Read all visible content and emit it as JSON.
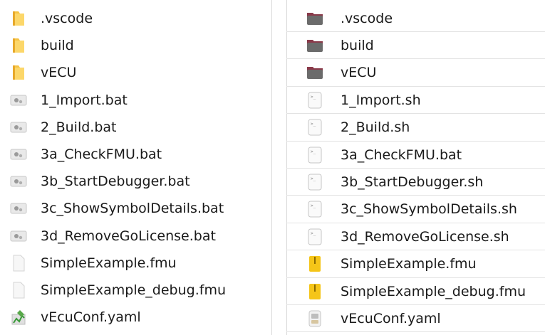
{
  "left_panel": {
    "items": [
      {
        "name": ".vscode",
        "icon": "folder-icon"
      },
      {
        "name": "build",
        "icon": "folder-icon"
      },
      {
        "name": "vECU",
        "icon": "folder-icon"
      },
      {
        "name": "1_Import.bat",
        "icon": "batch-file-icon"
      },
      {
        "name": "2_Build.bat",
        "icon": "batch-file-icon"
      },
      {
        "name": "3a_CheckFMU.bat",
        "icon": "batch-file-icon"
      },
      {
        "name": "3b_StartDebugger.bat",
        "icon": "batch-file-icon"
      },
      {
        "name": "3c_ShowSymbolDetails.bat",
        "icon": "batch-file-icon"
      },
      {
        "name": "3d_RemoveGoLicense.bat",
        "icon": "batch-file-icon"
      },
      {
        "name": "SimpleExample.fmu",
        "icon": "blank-file-icon"
      },
      {
        "name": "SimpleExample_debug.fmu",
        "icon": "blank-file-icon"
      },
      {
        "name": "vEcuConf.yaml",
        "icon": "yaml-file-icon"
      }
    ]
  },
  "right_panel": {
    "items": [
      {
        "name": ".vscode",
        "icon": "folder-icon"
      },
      {
        "name": "build",
        "icon": "folder-icon"
      },
      {
        "name": "vECU",
        "icon": "folder-icon"
      },
      {
        "name": "1_Import.sh",
        "icon": "shell-script-icon"
      },
      {
        "name": "2_Build.sh",
        "icon": "shell-script-icon"
      },
      {
        "name": "3a_CheckFMU.bat",
        "icon": "shell-script-icon"
      },
      {
        "name": "3b_StartDebugger.sh",
        "icon": "shell-script-icon"
      },
      {
        "name": "3c_ShowSymbolDetails.sh",
        "icon": "shell-script-icon"
      },
      {
        "name": "3d_RemoveGoLicense.sh",
        "icon": "shell-script-icon"
      },
      {
        "name": "SimpleExample.fmu",
        "icon": "archive-file-icon"
      },
      {
        "name": "SimpleExample_debug.fmu",
        "icon": "archive-file-icon"
      },
      {
        "name": "vEcuConf.yaml",
        "icon": "yaml-file-icon"
      }
    ]
  },
  "colors": {
    "win_folder": "#f6c343",
    "linux_folder": "#6b6b6b",
    "linux_folder_tab": "#8a3a4a",
    "archive_yellow": "#f5c518"
  }
}
